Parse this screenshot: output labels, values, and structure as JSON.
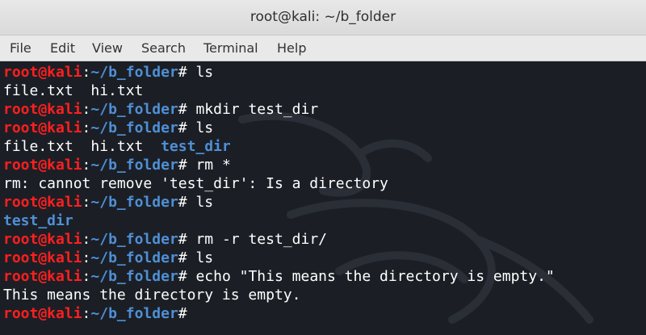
{
  "window": {
    "title": "root@kali: ~/b_folder"
  },
  "menu": [
    "File",
    "Edit",
    "View",
    "Search",
    "Terminal",
    "Help"
  ],
  "prompt": {
    "user_host": "root@kali",
    "colon": ":",
    "path": "~/b_folder",
    "hash": "#"
  },
  "colors": {
    "prompt_user": "#ff1f1f",
    "prompt_path": "#4f8fd6",
    "directory": "#4f8fd6",
    "background": "#1b1f25"
  },
  "terminal": {
    "lines": [
      {
        "type": "prompt",
        "command": " ls"
      },
      {
        "type": "output",
        "text": "file.txt  hi.txt"
      },
      {
        "type": "prompt",
        "command": " mkdir test_dir"
      },
      {
        "type": "prompt",
        "command": " ls"
      },
      {
        "type": "output",
        "text": "file.txt  hi.txt  ",
        "dir": "test_dir"
      },
      {
        "type": "prompt",
        "command": " rm *"
      },
      {
        "type": "output",
        "text": "rm: cannot remove 'test_dir': Is a directory"
      },
      {
        "type": "prompt",
        "command": " ls"
      },
      {
        "type": "output",
        "text": "",
        "dir": "test_dir"
      },
      {
        "type": "prompt",
        "command": " rm -r test_dir/"
      },
      {
        "type": "prompt",
        "command": " ls"
      },
      {
        "type": "prompt",
        "command": " echo \"This means the directory is empty.\""
      },
      {
        "type": "output",
        "text": "This means the directory is empty."
      },
      {
        "type": "prompt",
        "command": ""
      }
    ]
  }
}
